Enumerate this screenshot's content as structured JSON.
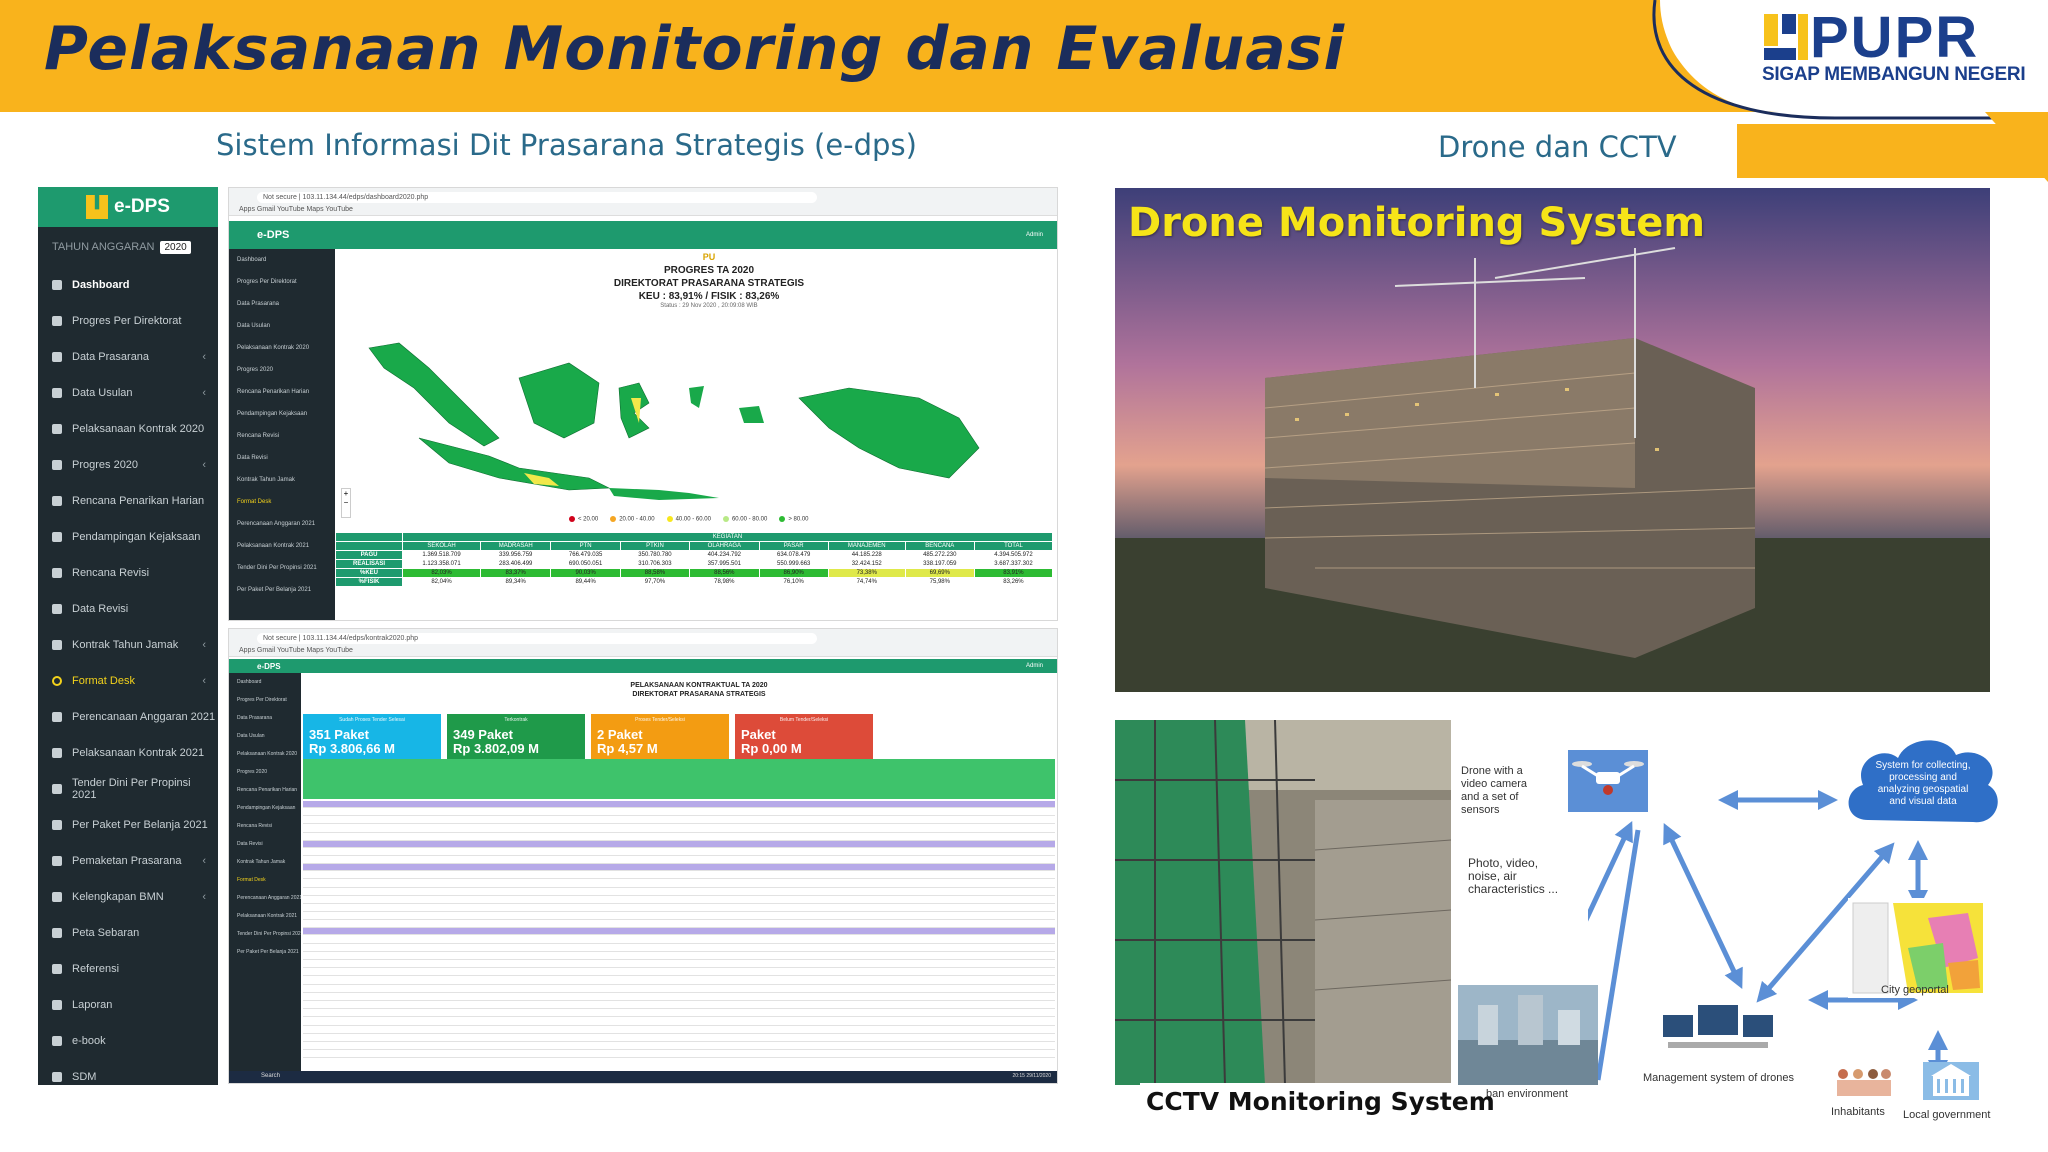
{
  "header": {
    "title": "Pelaksanaan Monitoring dan Evaluasi"
  },
  "logo": {
    "brand": "PUPR",
    "tagline": "SIGAP MEMBANGUN NEGERI"
  },
  "subtitles": {
    "left": "Sistem Informasi Dit Prasarana Strategis (e-dps)",
    "right": "Drone dan CCTV"
  },
  "edps_sidebar": {
    "logo_text": "e-DPS",
    "year_label": "TAHUN ANGGARAN",
    "year_value": "2020",
    "items": [
      {
        "label": "Dashboard"
      },
      {
        "label": "Progres Per Direktorat"
      },
      {
        "label": "Data Prasarana"
      },
      {
        "label": "Data Usulan"
      },
      {
        "label": "Pelaksanaan Kontrak 2020"
      },
      {
        "label": "Progres 2020"
      },
      {
        "label": "Rencana Penarikan Harian"
      },
      {
        "label": "Pendampingan Kejaksaan"
      },
      {
        "label": "Rencana Revisi"
      },
      {
        "label": "Data Revisi"
      },
      {
        "label": "Kontrak Tahun Jamak"
      },
      {
        "label": "Format Desk"
      },
      {
        "label": "Perencanaan Anggaran 2021"
      },
      {
        "label": "Pelaksanaan Kontrak 2021"
      },
      {
        "label": "Tender Dini Per Propinsi 2021"
      },
      {
        "label": "Per Paket Per Belanja 2021"
      },
      {
        "label": "Pemaketan Prasarana"
      },
      {
        "label": "Kelengkapan BMN"
      },
      {
        "label": "Peta Sebaran"
      },
      {
        "label": "Referensi"
      },
      {
        "label": "Laporan"
      },
      {
        "label": "e-book"
      },
      {
        "label": "SDM"
      }
    ]
  },
  "browser1": {
    "url": "Not secure | 103.11.134.44/edps/dashboard2020.php",
    "bookmarks": "Apps  Gmail  YouTube  Maps  YouTube",
    "app_logo": "e-DPS",
    "admin": "Admin",
    "map_logo": "PU",
    "map_title1": "PROGRES TA 2020",
    "map_title2": "DIREKTORAT PRASARANA STRATEGIS",
    "map_title3": "KEU : 83,91% / FISIK : 83,26%",
    "map_status": "Status : 29 Nov 2020 , 20:09:08 WIB",
    "legend": [
      "< 20.00",
      "20.00 - 40.00",
      "40.00 - 60.00",
      "60.00 - 80.00",
      "> 80.00"
    ],
    "mini_sidebar": [
      "Dashboard",
      "Progres Per Direktorat",
      "Data Prasarana",
      "Data Usulan",
      "Pelaksanaan Kontrak 2020",
      "Progres 2020",
      "Rencana Penarikan Harian",
      "Pendampingan Kejaksaan",
      "Rencana Revisi",
      "Data Revisi",
      "Kontrak Tahun Jamak",
      "Format Desk",
      "Perencanaan Anggaran 2021",
      "Pelaksanaan Kontrak 2021",
      "Tender Dini Per Propinsi 2021",
      "Per Paket Per Belanja 2021"
    ],
    "table": {
      "group": "KEGIATAN",
      "columns": [
        "SEKOLAH",
        "MADRASAH",
        "PTN",
        "PTKIN",
        "OLAHRAGA",
        "PASAR",
        "MANAJEMEN",
        "BENCANA",
        "TOTAL"
      ],
      "rows": [
        {
          "label": "PAGU",
          "values": [
            "1.369.518.709",
            "339.956.759",
            "766.479.035",
            "350.780.780",
            "404.234.792",
            "634.078.479",
            "44.185.228",
            "485.272.230",
            "4.394.505.972"
          ]
        },
        {
          "label": "REALISASI",
          "values": [
            "1.123.358.071",
            "283.406.499",
            "690.050.051",
            "310.706.303",
            "357.995.501",
            "550.999.663",
            "32.424.152",
            "338.197.059",
            "3.687.337.302"
          ]
        },
        {
          "label": "%KEU",
          "values": [
            "82,03%",
            "83,37%",
            "90,03%",
            "88,58%",
            "88,56%",
            "86,90%",
            "73,38%",
            "69,69%",
            "83,91%"
          ]
        },
        {
          "label": "%FISIK",
          "values": [
            "82,04%",
            "89,34%",
            "89,44%",
            "97,70%",
            "78,98%",
            "76,10%",
            "74,74%",
            "75,98%",
            "83,26%"
          ]
        }
      ]
    }
  },
  "browser2": {
    "url": "Not secure | 103.11.134.44/edps/kontrak2020.php",
    "bookmarks": "Apps  Gmail  YouTube  Maps  YouTube",
    "app_logo": "e-DPS",
    "admin": "Admin",
    "title1": "PELAKSANAAN KONTRAKTUAL TA 2020",
    "title2": "DIREKTORAT PRASARANA STRATEGIS",
    "cards": [
      {
        "caption": "Sudah Proses Tender Selesai",
        "line1": "351 Paket",
        "line2": "Rp 3.806,66 M",
        "color": "#17b6e6"
      },
      {
        "caption": "Terkontrak",
        "line1": "349 Paket",
        "line2": "Rp 3.802,09 M",
        "color": "#1f9a4a"
      },
      {
        "caption": "Proses Tender/Seleksi",
        "line1": "2 Paket",
        "line2": "Rp 4,57 M",
        "color": "#f39c12"
      },
      {
        "caption": "Belum Tender/Seleksi",
        "line1": "Paket",
        "line2": "Rp 0,00 M",
        "color": "#dd4b39"
      }
    ],
    "search": "Search",
    "clock": "20:15 29/11/2020"
  },
  "drone": {
    "title": "Drone Monitoring System"
  },
  "cctv": {
    "label": "CCTV Monitoring System"
  },
  "diagram": {
    "drone_caption": "Drone with a\nvideo camera\nnoise, air\nand a set of\nsensors",
    "drone_caption_lines": [
      "Drone with a",
      "video camera",
      "and a set of",
      "sensors"
    ],
    "photo_caption_lines": [
      "Photo, video,",
      "noise, air",
      "characteristics ..."
    ],
    "cloud_lines": [
      "System for collecting,",
      "processing and",
      "analyzing geospatial",
      "and visual data"
    ],
    "city_geoportal": "City geoportal",
    "urban_env": "ban environment",
    "mgmt": "Management system of drones",
    "inhabitants": "Inhabitants",
    "local_gov": "Local government"
  },
  "colors": {
    "header": "#f9b31c",
    "title": "#1b2d5c",
    "edps_green": "#1e9a6e",
    "drone_title": "#f6e418"
  }
}
